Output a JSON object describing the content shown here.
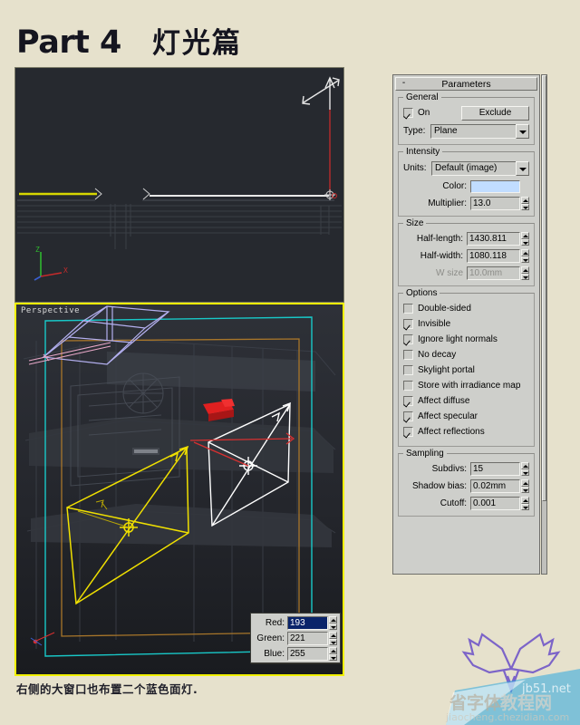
{
  "page": {
    "title_part": "Part 4",
    "title_cn": "灯光篇",
    "caption": "右侧的大窗口也布置二个蓝色面灯.",
    "background_color": "#e6e1cc"
  },
  "viewports": {
    "top": {
      "label": "",
      "background": "#26292f",
      "active": false
    },
    "perspective": {
      "label": "Perspective",
      "background": "#1e2024",
      "active": true,
      "border_color": "#f0f000"
    }
  },
  "panel": {
    "rollout": {
      "toggle": "-",
      "title": "Parameters"
    },
    "general": {
      "label": "General",
      "on_label": "On",
      "on_checked": true,
      "exclude_label": "Exclude",
      "type_label": "Type:",
      "type_value": "Plane"
    },
    "intensity": {
      "label": "Intensity",
      "units_label": "Units:",
      "units_value": "Default (image)",
      "color_label": "Color:",
      "color_value": "#c1ddff",
      "multiplier_label": "Multiplier:",
      "multiplier_value": "13.0"
    },
    "size": {
      "label": "Size",
      "half_length_label": "Half-length:",
      "half_length_value": "1430.811",
      "half_width_label": "Half-width:",
      "half_width_value": "1080.118",
      "w_size_label": "W size",
      "w_size_value": "10.0mm",
      "w_size_disabled": true
    },
    "options": {
      "label": "Options",
      "items": [
        {
          "label": "Double-sided",
          "checked": false
        },
        {
          "label": "Invisible",
          "checked": true
        },
        {
          "label": "Ignore light normals",
          "checked": true
        },
        {
          "label": "No decay",
          "checked": false
        },
        {
          "label": "Skylight portal",
          "checked": false
        },
        {
          "label": "Store with irradiance map",
          "checked": false
        },
        {
          "label": "Affect diffuse",
          "checked": true
        },
        {
          "label": "Affect specular",
          "checked": true
        },
        {
          "label": "Affect reflections",
          "checked": true
        }
      ]
    },
    "sampling": {
      "label": "Sampling",
      "subdivs_label": "Subdivs:",
      "subdivs_value": "15",
      "shadow_bias_label": "Shadow bias:",
      "shadow_bias_value": "0.02mm",
      "cutoff_label": "Cutoff:",
      "cutoff_value": "0.001"
    }
  },
  "rgb_picker": {
    "red_label": "Red:",
    "red_value": "193",
    "red_selected": true,
    "green_label": "Green:",
    "green_value": "221",
    "blue_label": "Blue:",
    "blue_value": "255"
  },
  "watermark": {
    "site": "jb51.net",
    "cn": "教程网",
    "url": "jiaocheng.chezidian.com"
  }
}
